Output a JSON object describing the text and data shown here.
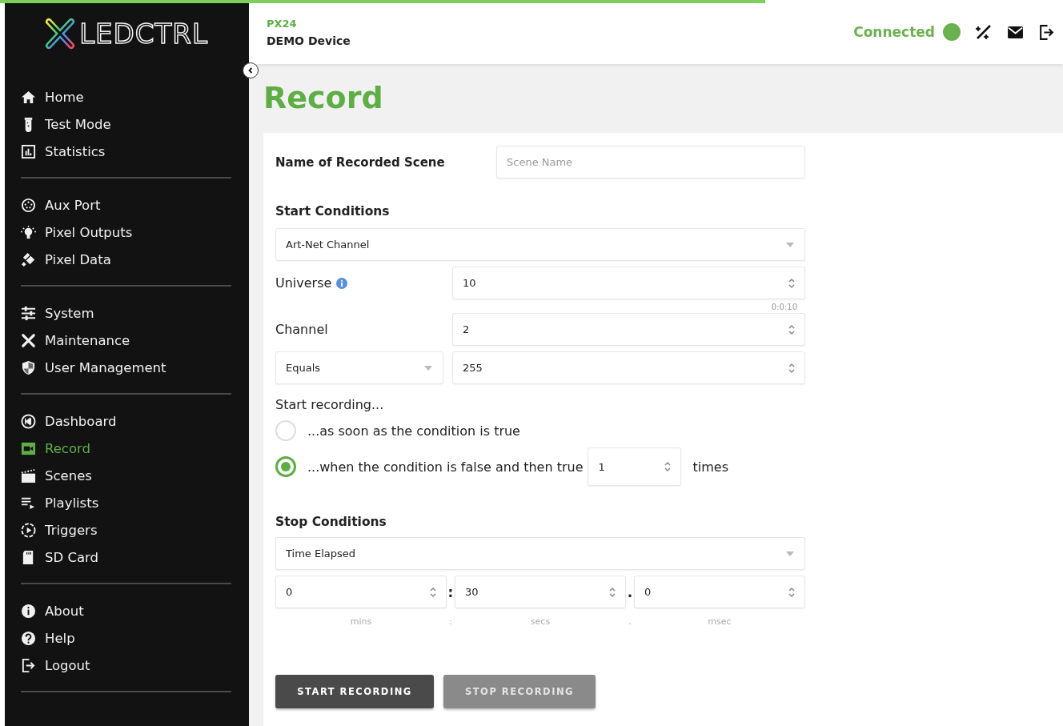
{
  "loading_bar": {
    "level": 0.72
  },
  "sidebar": {
    "logo": "LEDCTRL",
    "groups": [
      [
        {
          "label": "Home",
          "selected": false
        },
        {
          "label": "Test Mode",
          "selected": false
        },
        {
          "label": "Statistics",
          "selected": false
        }
      ],
      [
        {
          "label": "Aux Port",
          "selected": false
        },
        {
          "label": "Pixel Outputs",
          "selected": false
        },
        {
          "label": "Pixel Data",
          "selected": false
        }
      ],
      [
        {
          "label": "System",
          "selected": false
        },
        {
          "label": "Maintenance",
          "selected": false
        },
        {
          "label": "User Management",
          "selected": false
        }
      ],
      [
        {
          "label": "Dashboard",
          "selected": false
        },
        {
          "label": "Record",
          "selected": true
        },
        {
          "label": "Scenes",
          "selected": false
        },
        {
          "label": "Playlists",
          "selected": false
        },
        {
          "label": "Triggers",
          "selected": false
        },
        {
          "label": "SD Card",
          "selected": false
        }
      ],
      [
        {
          "label": "About",
          "selected": false
        },
        {
          "label": "Help",
          "selected": false
        },
        {
          "label": "Logout",
          "selected": false
        }
      ]
    ]
  },
  "header": {
    "model": "PX24",
    "device": "DEMO Device",
    "status": "Connected",
    "connected": true
  },
  "page_title": "Record",
  "form": {
    "scene_name": {
      "label": "Name of Recorded Scene",
      "placeholder": "Scene Name"
    },
    "start_conditions": {
      "heading": "Start Conditions",
      "source": "Art-Net Channel",
      "universe": {
        "label": "Universe",
        "value": "10",
        "hint": "0:0:10"
      },
      "channel": {
        "label": "Channel",
        "value": "2"
      },
      "comparison": "Equals",
      "threshold": "255",
      "prompt": "Start recording...",
      "options": [
        {
          "label": "...as soon as the condition is true",
          "selected": false
        },
        {
          "label": "...when the condition is false and then true",
          "selected": true,
          "count": "1",
          "suffix": "times"
        }
      ]
    },
    "stop_conditions": {
      "heading": "Stop Conditions",
      "source": "Time Elapsed",
      "time": [
        {
          "value": "0",
          "unit": "mins",
          "separator": ":"
        },
        {
          "value": "30",
          "unit": "secs",
          "separator": "."
        },
        {
          "value": "0",
          "unit": "msec"
        }
      ]
    },
    "buttons": [
      {
        "label": "START RECORDING",
        "disabled": false
      },
      {
        "label": "STOP RECORDING",
        "disabled": true
      }
    ]
  }
}
